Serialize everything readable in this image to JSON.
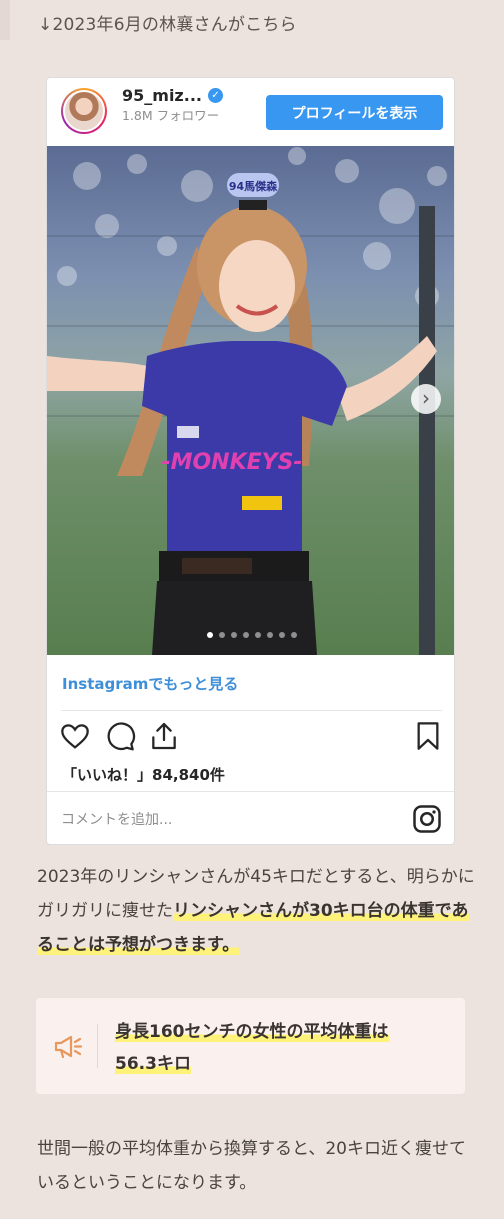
{
  "intro": "↓2023年6月の林襄さんがこちら",
  "instagram": {
    "username": "95_miz...",
    "followers": "1.8M フォロワー",
    "profile_button": "プロフィールを表示",
    "more_link": "Instagramでもっと見る",
    "likes": "「いいね！」84,840件",
    "comment_placeholder": "コメントを追加...",
    "carousel": {
      "total": 8,
      "active_index": 0
    },
    "photo_headband_text": "94馬傑森",
    "icons": [
      "heart-icon",
      "comment-icon",
      "share-icon",
      "bookmark-icon",
      "instagram-icon",
      "verified-icon",
      "chevron-right-icon"
    ],
    "accent_color": "#3897f0"
  },
  "paragraph1": {
    "plain": "2023年のリンシャンさんが45キロだとすると、明らかにガリガリに痩せた",
    "highlight": "リンシャンさんが30キロ台の体重であることは予想がつきます。"
  },
  "note": {
    "icon": "megaphone-icon",
    "line1": "身長160センチの女性の平均体重は",
    "line2": "56.3キロ"
  },
  "paragraph2": "世間一般の平均体重から換算すると、20キロ近く痩せているということになります。"
}
